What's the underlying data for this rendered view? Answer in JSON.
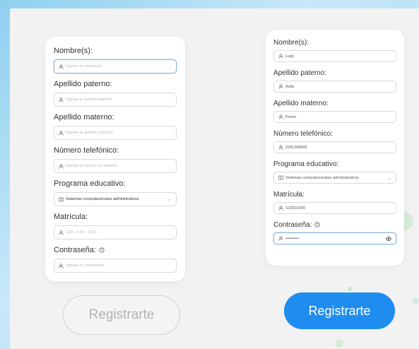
{
  "form_empty": {
    "fields": [
      {
        "label": "Nombre(s):",
        "placeholder": "Ingresa tu nombre(s)"
      },
      {
        "label": "Apellido paterno:",
        "placeholder": "Ingresa tu apellido paterno"
      },
      {
        "label": "Apellido materno:",
        "placeholder": "Ingresa tu apellido materno"
      },
      {
        "label": "Número telefónico:",
        "placeholder": "Ingresa tu número de teléfono"
      },
      {
        "label": "Programa educativo:",
        "value": "Sistemas computacionales administrativos"
      },
      {
        "label": "Matrícula:",
        "placeholder": "S20... S19... S18..."
      },
      {
        "label": "Contraseña:",
        "placeholder": "Ingresa tu contraseña"
      }
    ],
    "button_label": "Registrarte"
  },
  "form_filled": {
    "fields": [
      {
        "label": "Nombre(s):",
        "value": "Luigi"
      },
      {
        "label": "Apellido paterno:",
        "value": "Avila"
      },
      {
        "label": "Apellido materno:",
        "value": "Flores"
      },
      {
        "label": "Número telefónico:",
        "value": "2281288900"
      },
      {
        "label": "Programa educativo:",
        "value": "Sistemas computacionales administrativos"
      },
      {
        "label": "Matrícula:",
        "value": "S20014200"
      },
      {
        "label": "Contraseña:",
        "value": "••••••••••"
      }
    ],
    "button_label": "Registrarte"
  },
  "colors": {
    "primary": "#1f8df0",
    "disabled_text": "#b3b3b3",
    "background": "#f2f2f2",
    "decor_dots": "#d6ecd9"
  }
}
